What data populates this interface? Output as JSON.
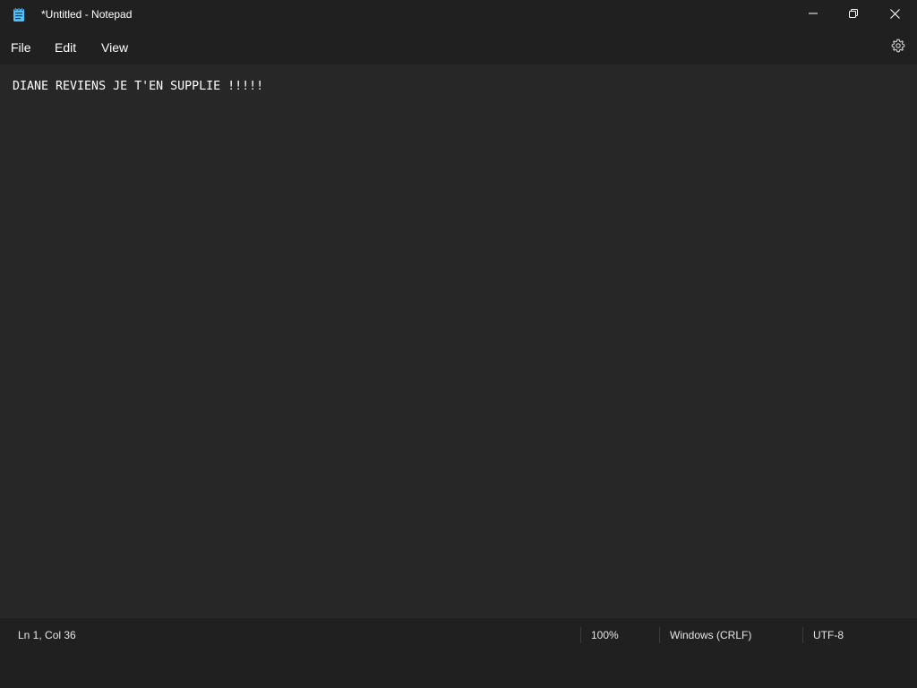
{
  "window": {
    "title": "*Untitled - Notepad",
    "app_icon": "notepad-icon",
    "controls": {
      "minimize": "minimize-icon",
      "maximize": "restore-icon",
      "close": "close-icon"
    }
  },
  "menu": {
    "items": [
      {
        "label": "File"
      },
      {
        "label": "Edit"
      },
      {
        "label": "View"
      }
    ],
    "settings_icon": "gear-icon"
  },
  "editor": {
    "content": "DIANE REVIENS JE T'EN SUPPLIE !!!!!"
  },
  "status": {
    "position": "Ln 1, Col 36",
    "zoom": "100%",
    "line_ending": "Windows (CRLF)",
    "encoding": "UTF-8"
  },
  "colors": {
    "chrome_bg": "#202020",
    "editor_bg": "#272727",
    "text": "#ffffff",
    "icon_accent": "#4cc2ff"
  }
}
